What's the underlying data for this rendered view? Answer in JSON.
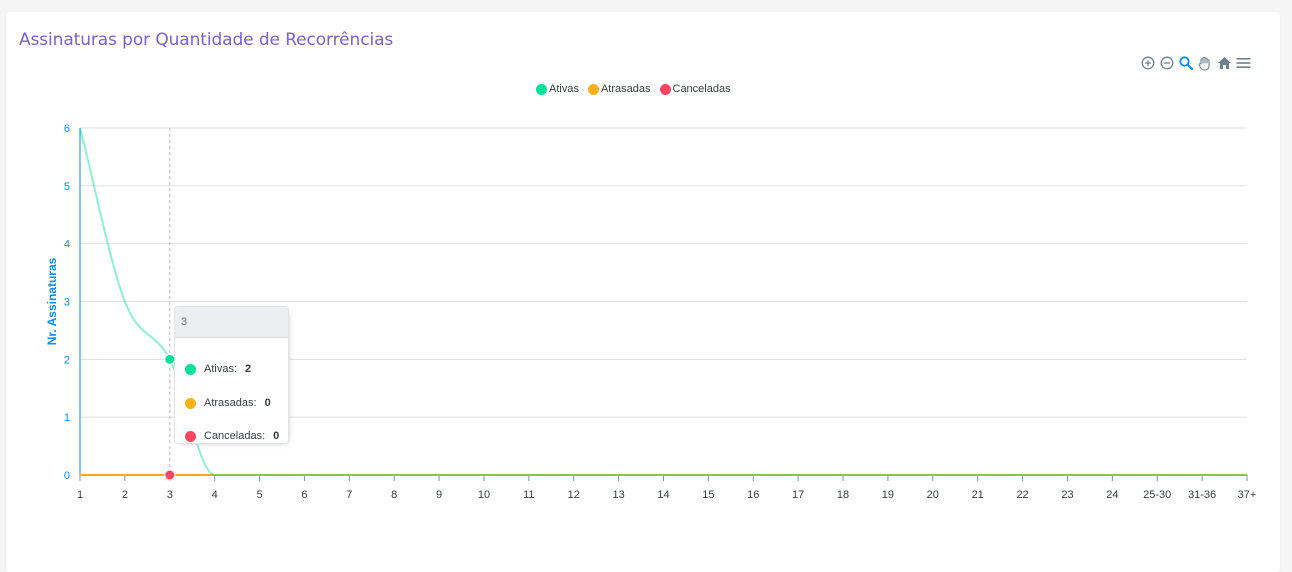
{
  "card": {
    "title": "Assinaturas por Quantidade de Recorrências"
  },
  "toolbar": {
    "zoom_in_icon": "zoom-in-icon",
    "zoom_out_icon": "zoom-out-icon",
    "selection_zoom_icon": "magnifier-icon",
    "pan_icon": "hand-icon",
    "reset_icon": "home-icon",
    "menu_icon": "hamburger-menu-icon"
  },
  "colors": {
    "title": "#7b5fd6",
    "axis": "#008ffb",
    "grid": "#e0e0e0",
    "ativas": "#00e396",
    "atrasadas": "#feb019",
    "canceladas": "#ff4560",
    "tooltip_header": "#eceff1"
  },
  "tooltip": {
    "title": "3",
    "rows": [
      {
        "label": "Ativas:",
        "value": "2",
        "color": "#00e396"
      },
      {
        "label": "Atrasadas:",
        "value": "0",
        "color": "#feb019"
      },
      {
        "label": "Canceladas:",
        "value": "0",
        "color": "#ff4560"
      }
    ]
  },
  "chart_data": {
    "type": "line",
    "title": "Assinaturas por Quantidade de Recorrências",
    "xlabel": "",
    "ylabel": "Nr. Assinaturas",
    "categories": [
      "1",
      "2",
      "3",
      "4",
      "5",
      "6",
      "7",
      "8",
      "9",
      "10",
      "11",
      "12",
      "13",
      "14",
      "15",
      "16",
      "17",
      "18",
      "19",
      "20",
      "21",
      "22",
      "23",
      "24",
      "25-30",
      "31-36",
      "37+"
    ],
    "series": [
      {
        "name": "Ativas",
        "color": "#00e396",
        "values": [
          6,
          3,
          2,
          0,
          0,
          0,
          0,
          0,
          0,
          0,
          0,
          0,
          0,
          0,
          0,
          0,
          0,
          0,
          0,
          0,
          0,
          0,
          0,
          0,
          0,
          0,
          0
        ]
      },
      {
        "name": "Atrasadas",
        "color": "#feb019",
        "values": [
          0,
          0,
          0,
          0,
          0,
          0,
          0,
          0,
          0,
          0,
          0,
          0,
          0,
          0,
          0,
          0,
          0,
          0,
          0,
          0,
          0,
          0,
          0,
          0,
          0,
          0,
          0
        ]
      },
      {
        "name": "Canceladas",
        "color": "#ff4560",
        "values": [
          0,
          0,
          0,
          0,
          0,
          0,
          0,
          0,
          0,
          0,
          0,
          0,
          0,
          0,
          0,
          0,
          0,
          0,
          0,
          0,
          0,
          0,
          0,
          0,
          0,
          0,
          0
        ]
      }
    ],
    "yticks": [
      0,
      1,
      2,
      3,
      4,
      5,
      6
    ],
    "ylim": [
      0,
      6
    ],
    "grid": true,
    "legend": "top-center",
    "smooth": true,
    "hover_category": "3"
  }
}
